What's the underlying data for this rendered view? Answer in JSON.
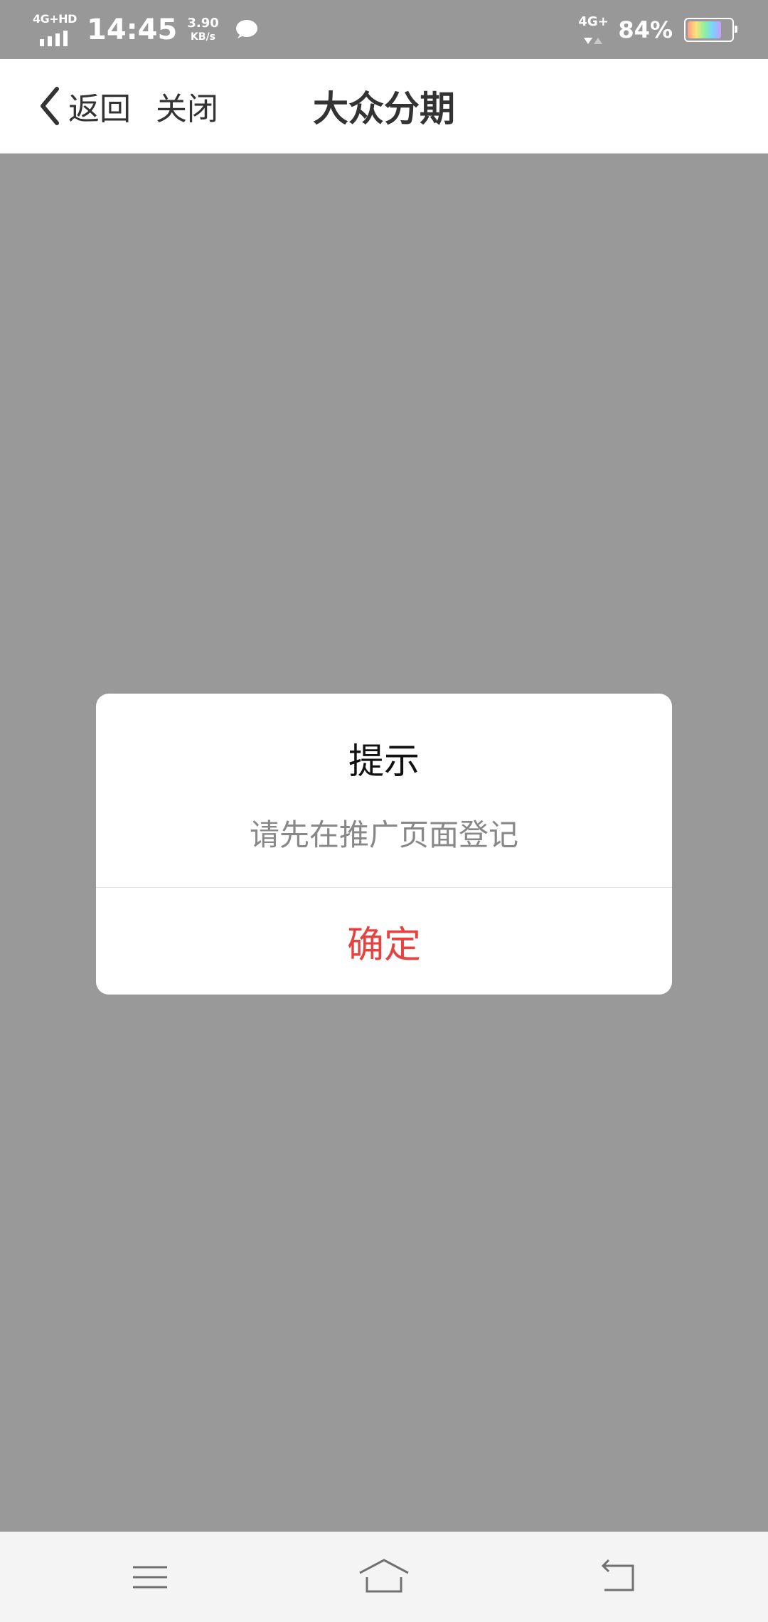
{
  "status_bar": {
    "network_left": "4G+HD",
    "time": "14:45",
    "speed_value": "3.90",
    "speed_unit": "KB/s",
    "network_right": "4G+",
    "battery_percent": "84%",
    "battery_level": 0.84
  },
  "header": {
    "back_label": "返回",
    "close_label": "关闭",
    "title": "大众分期"
  },
  "dialog": {
    "title": "提示",
    "message": "请先在推广页面登记",
    "confirm_label": "确定",
    "confirm_color": "#e64340"
  },
  "navbar": {
    "icons": [
      "menu-icon",
      "home-icon",
      "back-icon"
    ]
  },
  "colors": {
    "overlay_background": "#999999",
    "header_background": "#ffffff",
    "navbar_background": "#f4f4f4"
  }
}
